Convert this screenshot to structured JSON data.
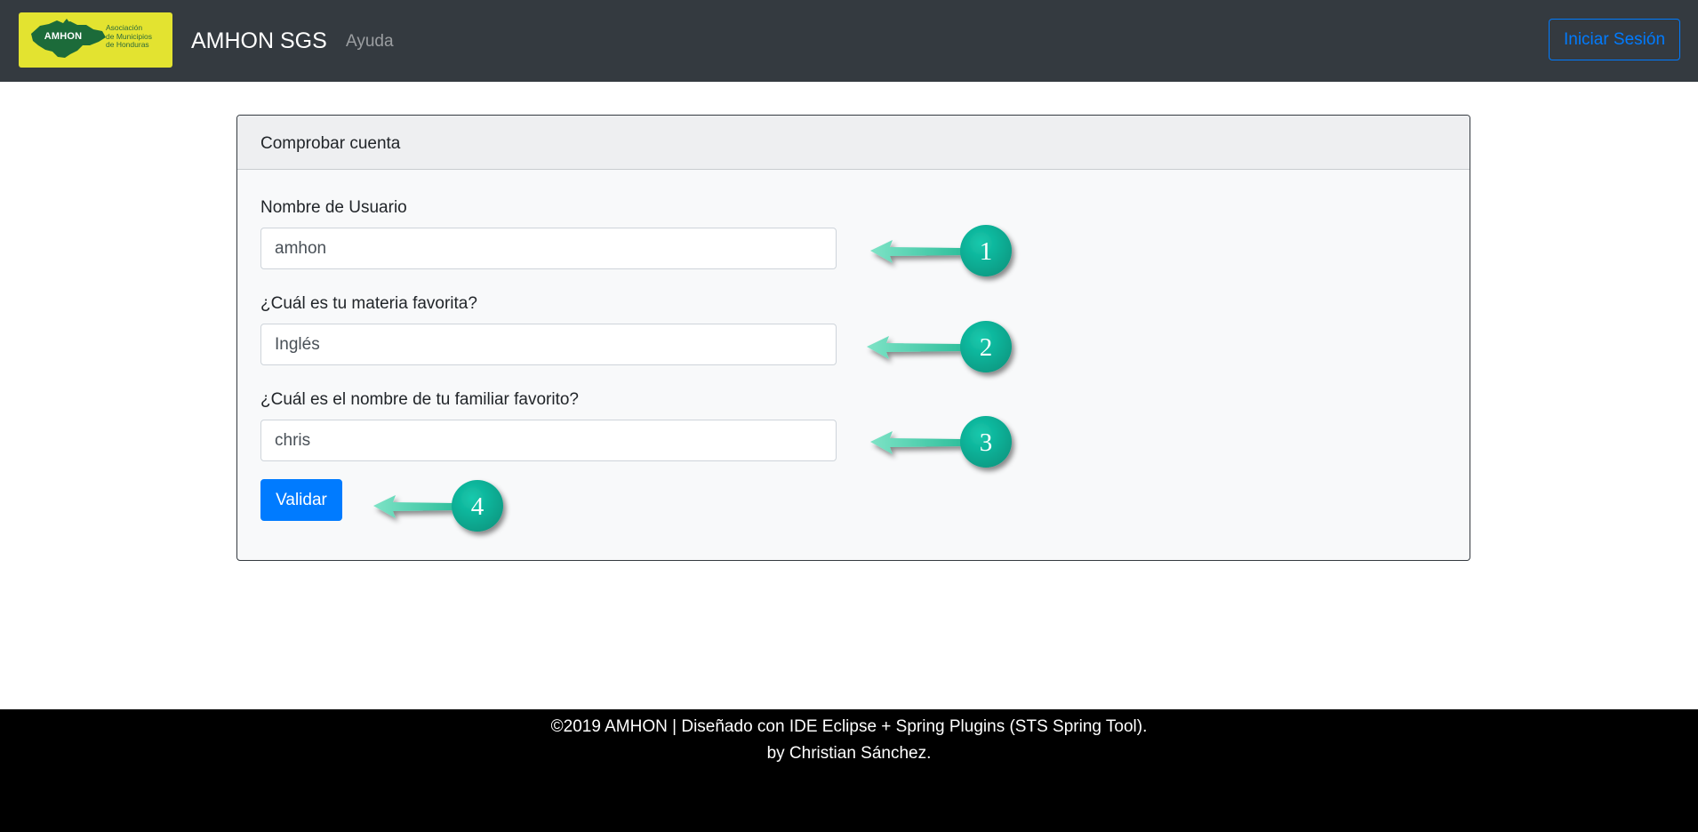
{
  "navbar": {
    "logo_abbr": "AMHON",
    "logo_text": [
      "Asociación",
      "de Municipios",
      "de Honduras"
    ],
    "brand": "AMHON SGS",
    "help_link": "Ayuda",
    "login_button": "Iniciar Sesión"
  },
  "card": {
    "title": "Comprobar cuenta",
    "fields": [
      {
        "label": "Nombre de Usuario",
        "value": "amhon"
      },
      {
        "label": "¿Cuál es tu materia favorita?",
        "value": "Inglés"
      },
      {
        "label": "¿Cuál es el nombre de tu familiar favorito?",
        "value": "chris"
      }
    ],
    "submit_button": "Validar"
  },
  "annotations": [
    "1",
    "2",
    "3",
    "4"
  ],
  "footer": {
    "line1": "©2019 AMHON | Diseñado con IDE Eclipse + Spring Plugins (STS Spring Tool).",
    "line2": "by Christian Sánchez."
  },
  "colors": {
    "navbar_bg": "#343a40",
    "primary": "#007bff",
    "logo_bg": "#e3e330",
    "annotation_teal": "#0fb39a",
    "arrow_teal": "#52d4b2",
    "footer_bg": "#000000"
  },
  "icons": [
    "honduras-map-logo",
    "arrow-left-icon",
    "number-badge"
  ]
}
